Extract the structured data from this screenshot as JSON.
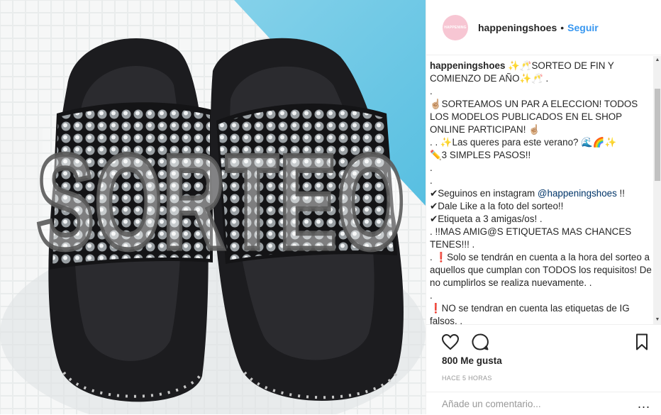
{
  "post": {
    "username": "happeningshoes",
    "follow_label": "Seguir",
    "separator": "•",
    "avatar_text": "HAPPENING",
    "image_overlay_text": "SORTEO"
  },
  "caption": {
    "username": "happeningshoes",
    "lines": [
      " ✨🥂SORTEO DE FIN Y COMIENZO DE AÑO✨🥂 .",
      ".",
      "☝🏼SORTEAMOS UN PAR A ELECCION! TODOS LOS MODELOS PUBLICADOS EN EL SHOP ONLINE PARTICIPAN! ☝🏼",
      ". . ✨Las queres para este verano? 🌊🌈✨",
      "✏️3 SIMPLES PASOS!!",
      ".",
      "."
    ],
    "follow_step_prefix": "✔Seguinos en instagram ",
    "follow_step_mention": "@happeningshoes",
    "follow_step_suffix": " !!",
    "lines_after": [
      "✔Dale Like a la foto del sorteo!!",
      "✔Etiqueta a 3 amigas/os! .",
      ". !!MAS AMIG@S ETIQUETAS MAS CHANCES TENES!!! .",
      ". ❗Solo se tendrán en cuenta a la hora del sorteo a aquellos que cumplan con TODOS los requisitos! De no cumplirlos se realiza nuevamente. .",
      ".",
      "❗NO se tendran en cuenta las etiquetas de IG falsos. ."
    ]
  },
  "engagement": {
    "likes": "800 Me gusta",
    "time": "HACE 5 HORAS"
  },
  "comment": {
    "placeholder": "Añade un comentario...",
    "more": "..."
  }
}
